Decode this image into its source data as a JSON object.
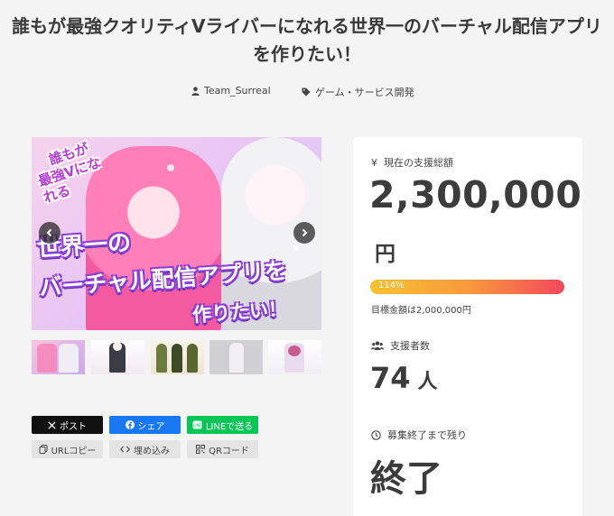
{
  "project": {
    "title": "誰もが最強クオリティVライバーになれる世界一のバーチャル配信アプリを作りたい！",
    "owner": "Team_Surreal",
    "category": "ゲーム・サービス開発"
  },
  "hero": {
    "corner_line1": "誰もが",
    "corner_line2": "最強Vになれる",
    "line1": "世界一の",
    "line2": "バーチャル配信アプリを",
    "line3": "作りたい！"
  },
  "share": {
    "x_label": "ポスト",
    "facebook_label": "シェア",
    "line_label": "LINEで送る",
    "url_label": "URLコピー",
    "embed_label": "埋め込み",
    "qr_label": "QRコード"
  },
  "funding": {
    "amount_label": "現在の支援総額",
    "amount_value": "2,300,000",
    "currency": "円",
    "progress_text": "114%",
    "progress_percent": 114,
    "goal_text": "目標金額は2,000,000円",
    "supporters_label": "支援者数",
    "supporters_value": "74",
    "supporters_unit": "人",
    "remaining_label": "募集終了まで残り",
    "remaining_value": "終了"
  },
  "colors": {
    "x": "#111111",
    "facebook": "#1877f2",
    "line": "#06c755",
    "progress_start": "#f7c230",
    "progress_end": "#f2485b"
  },
  "icons": {
    "owner": "user-icon",
    "category": "tag-icon",
    "amount": "yen-icon",
    "supporters": "users-icon",
    "remaining": "clock-icon"
  }
}
